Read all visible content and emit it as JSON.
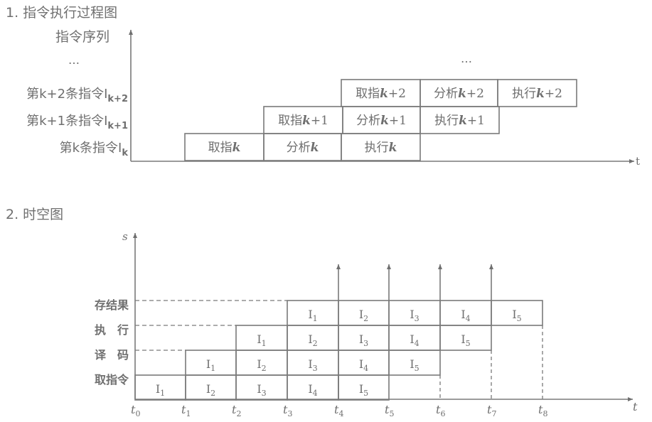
{
  "part1": {
    "title": "1. 指令执行过程图",
    "y_axis_label": "指令序列",
    "x_axis_label": "t",
    "ellipsis": "…",
    "rows": [
      {
        "label_main": "第k条指令I",
        "label_sub": "k",
        "cells": [
          {
            "op": "取指",
            "var": "k"
          },
          {
            "op": "分析",
            "var": "k"
          },
          {
            "op": "执行",
            "var": "k"
          }
        ]
      },
      {
        "label_main": "第k+1条指令I",
        "label_sub": "k+1",
        "cells": [
          {
            "op": "取指",
            "var": "k",
            "suffix": "+1"
          },
          {
            "op": "分析",
            "var": "k",
            "suffix": "+1"
          },
          {
            "op": "执行",
            "var": "k",
            "suffix": "+1"
          }
        ]
      },
      {
        "label_main": "第k+2条指令I",
        "label_sub": "k+2",
        "cells": [
          {
            "op": "取指",
            "var": "k",
            "suffix": "+2"
          },
          {
            "op": "分析",
            "var": "k",
            "suffix": "+2"
          },
          {
            "op": "执行",
            "var": "k",
            "suffix": "+2"
          }
        ]
      }
    ]
  },
  "part2": {
    "title": "2. 时空图",
    "y_axis_label": "s",
    "x_axis_label": "t",
    "stages": [
      "取指令",
      "译　码",
      "执　行",
      "存结果"
    ],
    "instruction_prefix": "I",
    "rows": [
      {
        "stage": "取指令",
        "items": [
          "1",
          "2",
          "3",
          "4",
          "5"
        ]
      },
      {
        "stage": "译码",
        "items": [
          "1",
          "2",
          "3",
          "4",
          "5"
        ]
      },
      {
        "stage": "执行",
        "items": [
          "1",
          "2",
          "3",
          "4",
          "5"
        ]
      },
      {
        "stage": "存结果",
        "items": [
          "1",
          "2",
          "3",
          "4",
          "5"
        ]
      }
    ],
    "ticks": [
      "0",
      "1",
      "2",
      "3",
      "4",
      "5",
      "6",
      "7",
      "8"
    ],
    "tick_prefix": "t"
  }
}
